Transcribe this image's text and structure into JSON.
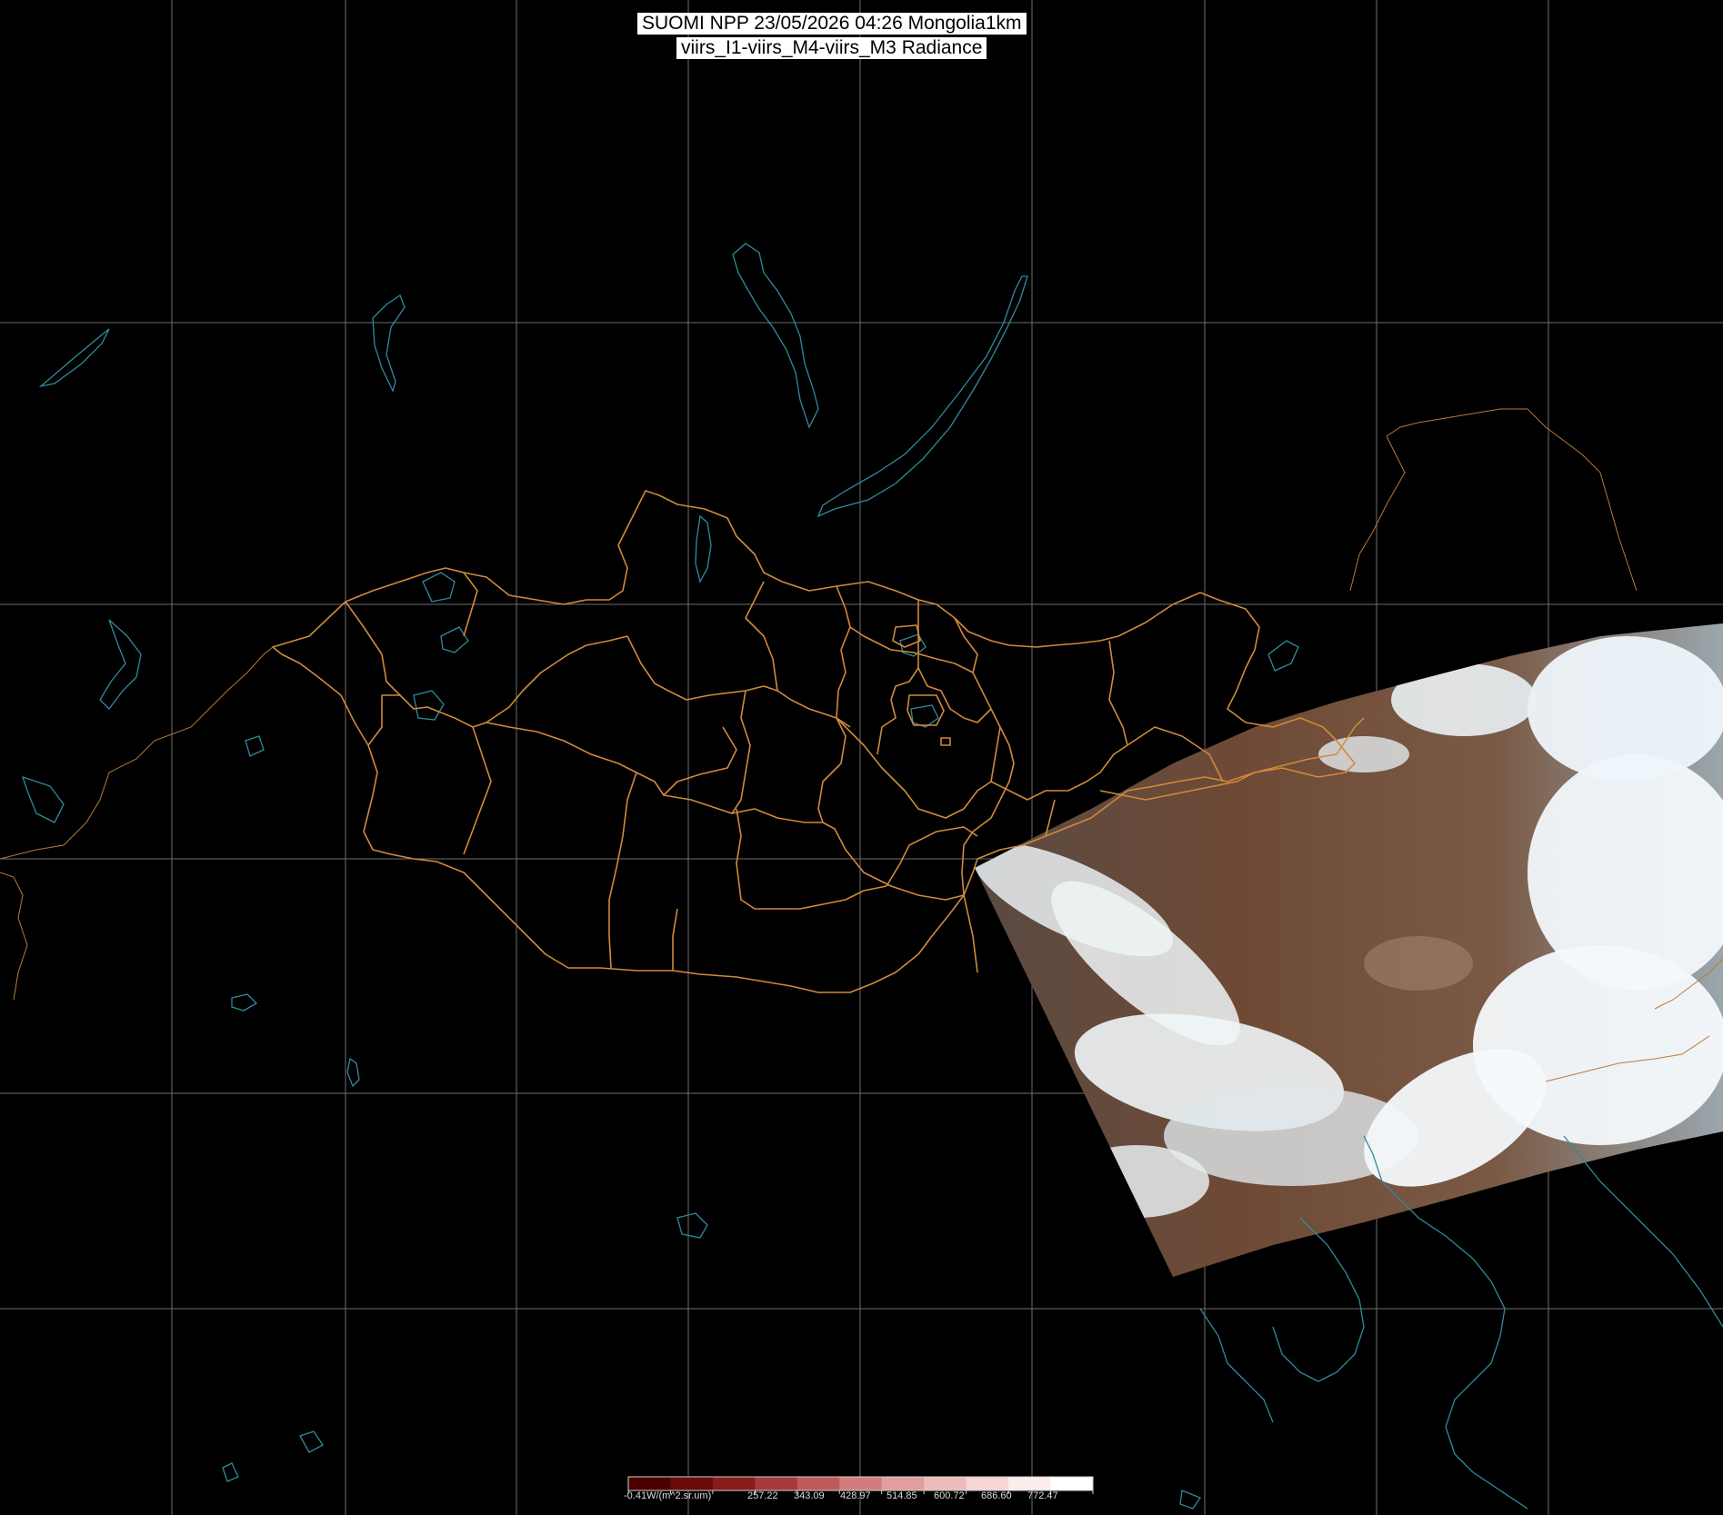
{
  "title": {
    "line1": "SUOMI NPP 23/05/2026 04:26 Mongolia1km",
    "line2": "viirs_I1-viirs_M4-viirs_M3 Radiance"
  },
  "map": {
    "region": "Mongolia",
    "graticule": "on",
    "layers": [
      "graticule",
      "coastlines-lakes",
      "mongolia-province-borders",
      "satellite-swath"
    ],
    "colors": {
      "background": "#000000",
      "graticule": "#6e6e6e",
      "borders": "#d08a3c",
      "coastlines": "#2f8b9e",
      "swath_land": "#6e4a36",
      "swath_cloud": "#eef6fb"
    }
  },
  "colorbar": {
    "labels": [
      "-0.41W/(m^2.sr.um)",
      "257.22",
      "343.09",
      "428.97",
      "514.85",
      "600.72",
      "686.60",
      "772.47"
    ],
    "colors": [
      "#4a0000",
      "#6a0a0a",
      "#8a1c1c",
      "#a63a3a",
      "#bf5a5a",
      "#d27d7d",
      "#e29e9e",
      "#eebbbb",
      "#f6d6d6",
      "#fcecec",
      "#ffffff"
    ]
  }
}
